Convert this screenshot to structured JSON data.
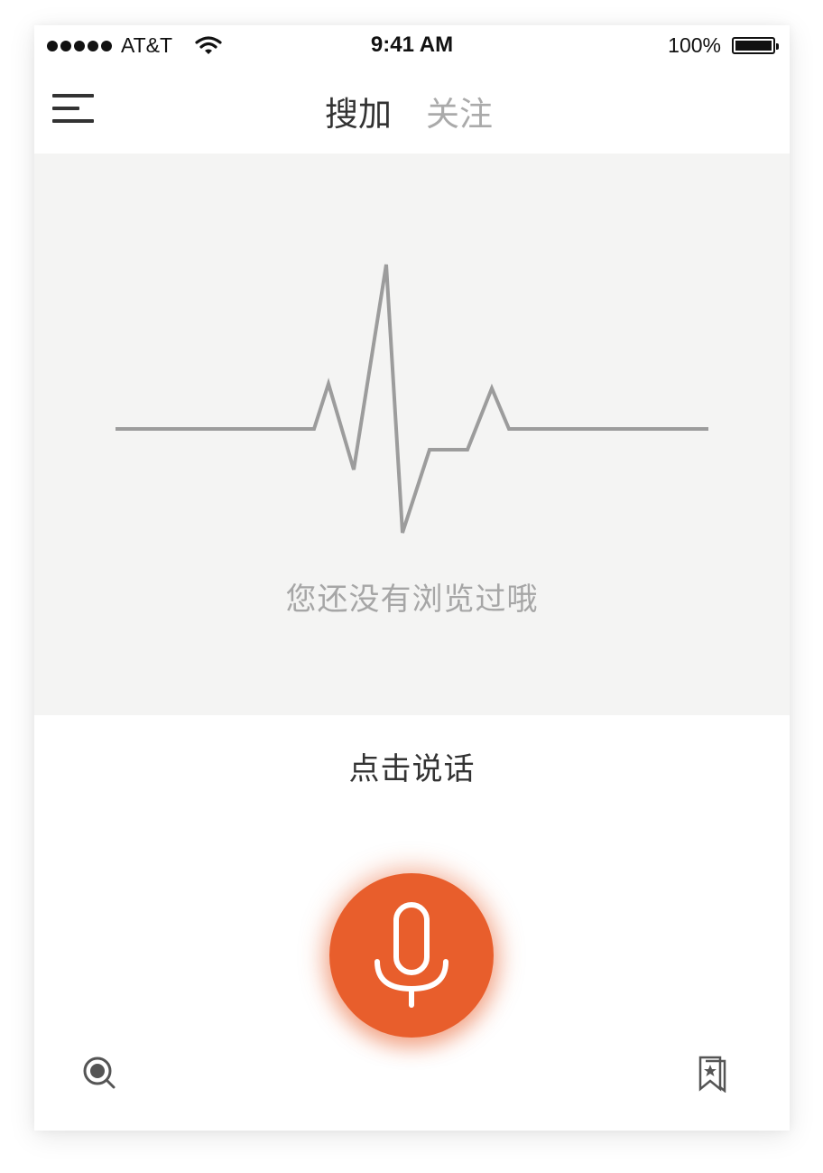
{
  "status_bar": {
    "carrier": "AT&T",
    "time": "9:41 AM",
    "battery": "100%",
    "signal_icon": "signal-dots-icon",
    "wifi_icon": "wifi-icon",
    "battery_icon": "battery-icon"
  },
  "nav": {
    "menu_icon": "menu-icon",
    "tabs": [
      {
        "label": "搜加",
        "active": true
      },
      {
        "label": "关注",
        "active": false
      }
    ]
  },
  "history": {
    "illustration_icon": "heartbeat-line-icon",
    "empty_message": "您还没有浏览过哦"
  },
  "voice": {
    "prompt": "点击说话",
    "mic_icon": "microphone-icon",
    "accent_color": "#e85e2c"
  },
  "bottom_bar": {
    "left_icon": "scan-search-icon",
    "right_icon": "bookmark-star-icon"
  }
}
